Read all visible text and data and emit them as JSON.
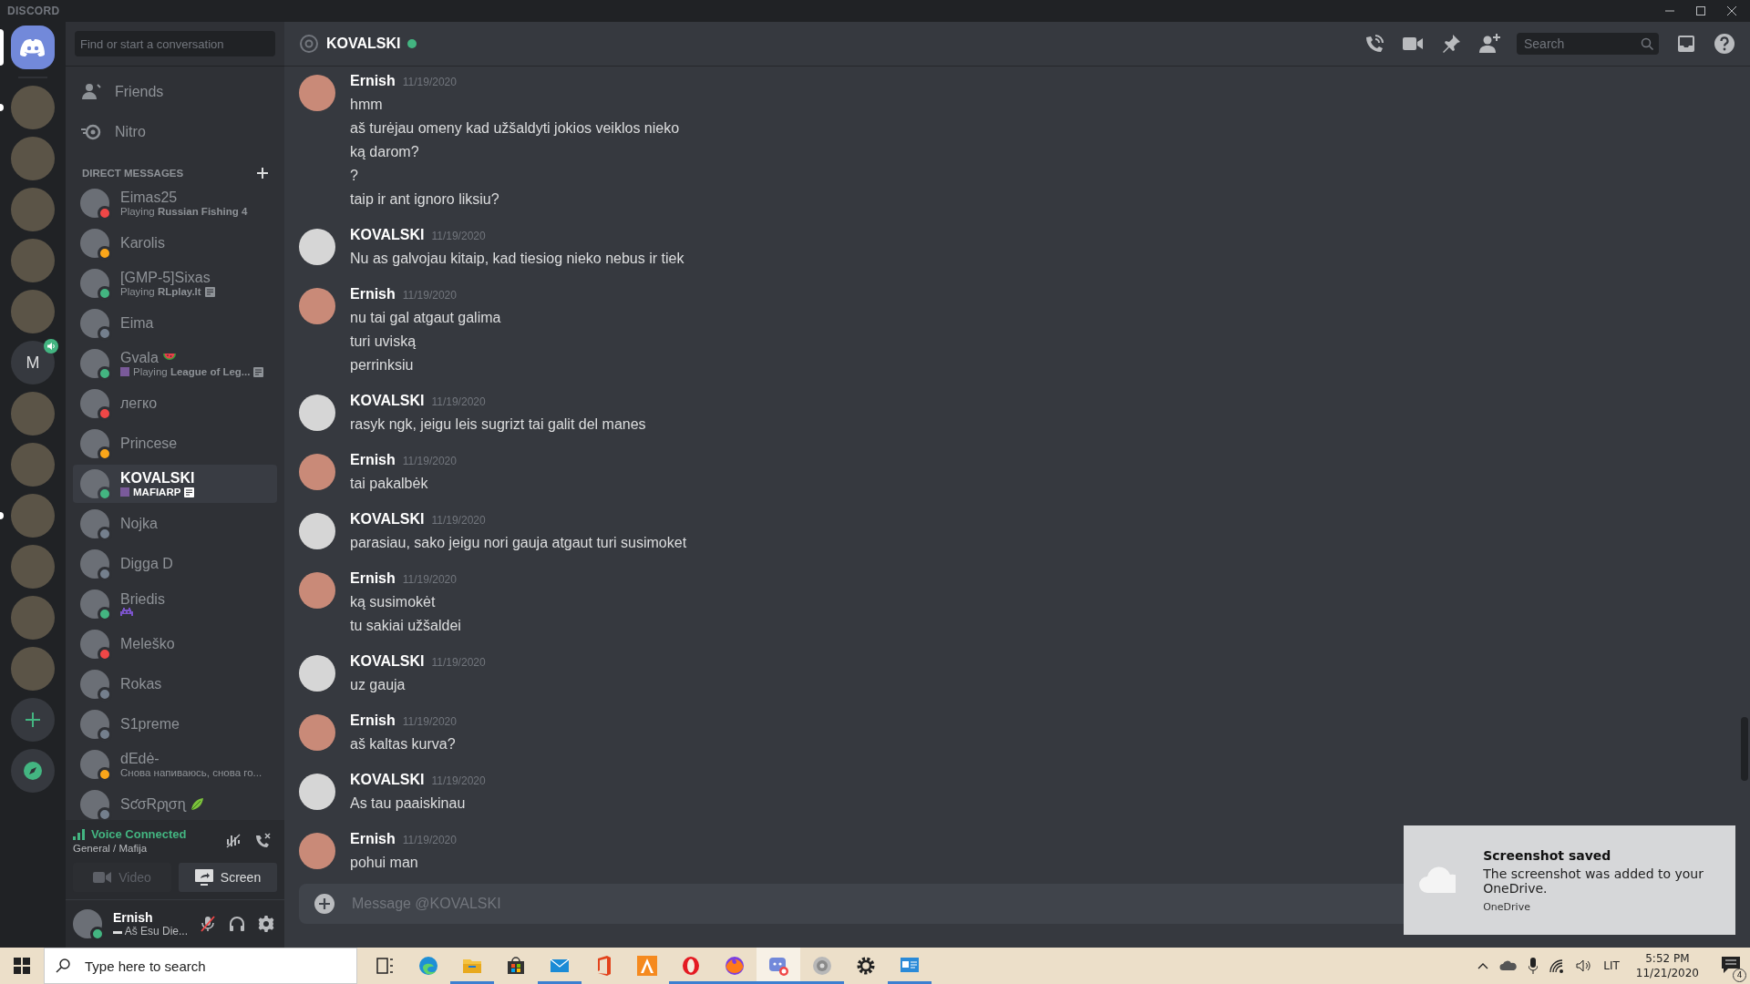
{
  "title_bar": {
    "title": "DISCORD"
  },
  "servers": [
    {
      "kind": "home",
      "selected": true,
      "unread": false,
      "voice": false
    },
    {
      "kind": "photo",
      "selected": false,
      "unread": true,
      "voice": false
    },
    {
      "kind": "photo",
      "selected": false,
      "unread": false,
      "voice": false
    },
    {
      "kind": "photo",
      "selected": false,
      "unread": false,
      "voice": false
    },
    {
      "kind": "photo",
      "selected": false,
      "unread": false,
      "voice": false
    },
    {
      "kind": "photo",
      "selected": false,
      "unread": false,
      "voice": false
    },
    {
      "kind": "letter",
      "label": "M",
      "selected": false,
      "unread": false,
      "voice": true
    },
    {
      "kind": "photo",
      "selected": false,
      "unread": false,
      "voice": false
    },
    {
      "kind": "photo",
      "selected": false,
      "unread": false,
      "voice": false
    },
    {
      "kind": "photo",
      "selected": false,
      "unread": true,
      "voice": false
    },
    {
      "kind": "photo",
      "selected": false,
      "unread": false,
      "voice": false
    },
    {
      "kind": "photo",
      "selected": false,
      "unread": false,
      "voice": false
    },
    {
      "kind": "photo",
      "selected": false,
      "unread": false,
      "voice": false
    },
    {
      "kind": "add",
      "selected": false,
      "unread": false,
      "voice": false
    },
    {
      "kind": "explore",
      "selected": false,
      "unread": false,
      "voice": false
    }
  ],
  "dm_sidebar": {
    "search_button": "Find or start a conversation",
    "nav": [
      {
        "kind": "friends",
        "label": "Friends"
      },
      {
        "kind": "nitro",
        "label": "Nitro"
      }
    ],
    "section_title": "DIRECT MESSAGES",
    "conversations": [
      {
        "name": "Eimas25",
        "activity": {
          "verb": "Playing",
          "name": "Russian Fishing 4"
        },
        "color": "#f04747",
        "selected": false
      },
      {
        "name": "Karolis",
        "color": "#faa61a",
        "selected": false
      },
      {
        "name": "[GMP-5]Sixas",
        "activity": {
          "verb": "Playing",
          "name": "RLplay.lt"
        },
        "details": true,
        "color": "#43b581",
        "selected": false
      },
      {
        "name": "Eima",
        "color": "#747f8d",
        "selected": false
      },
      {
        "name": "Gvala",
        "emoji": {
          "kind": "watermelon"
        },
        "activity": {
          "verb": "Playing",
          "name": "League of Leg..."
        },
        "activity_image": true,
        "details": true,
        "color": "#43b581",
        "selected": false
      },
      {
        "name": "легко",
        "color": "#f04747",
        "selected": false
      },
      {
        "name": "Princese",
        "color": "#faa61a",
        "selected": false
      },
      {
        "name": "KOVALSKI",
        "activity": {
          "name": "MAFIARP"
        },
        "activity_image": true,
        "details": true,
        "color": "#43b581",
        "selected": true
      },
      {
        "name": "Nojka",
        "color": "#747f8d",
        "selected": false
      },
      {
        "name": "Digga D",
        "color": "#747f8d",
        "selected": false
      },
      {
        "name": "Briedis",
        "status_emoji": {
          "kind": "invader"
        },
        "color": "#43b581",
        "selected": false
      },
      {
        "name": "Meleško",
        "color": "#f04747",
        "selected": false
      },
      {
        "name": "Rokas",
        "color": "#747f8d",
        "selected": false
      },
      {
        "name": "S1preme",
        "color": "#747f8d",
        "selected": false
      },
      {
        "name": "dEdė-",
        "status_text": "Снова напиваюсь, снова го...",
        "color": "#faa61a",
        "selected": false
      },
      {
        "name": "SƈσRρʅσɳ",
        "emoji": {
          "kind": "leaf"
        },
        "color": "#747f8d",
        "selected": false
      }
    ]
  },
  "voice": {
    "title": "Voice Connected",
    "channel": "General / Mafija",
    "buttons": [
      {
        "kind": "video",
        "label": "Video",
        "disabled": true
      },
      {
        "kind": "screen",
        "label": "Screen",
        "disabled": false
      }
    ]
  },
  "user": {
    "name": "Ernish",
    "status": "Aš Esu Die...",
    "color": "#43b581",
    "muted": true
  },
  "chat": {
    "header": {
      "name": "KOVALSKI",
      "color": "#43b581",
      "search_placeholder": "Search"
    },
    "messages": [
      {
        "author": "Ernish",
        "date": "11/19/2020",
        "lines": [
          "hmm",
          "aš turėjau omeny kad užšaldyti jokios veiklos nieko",
          "ką darom?",
          "?",
          "taip ir ant ignoro liksiu?"
        ]
      },
      {
        "author": "KOVALSKI",
        "date": "11/19/2020",
        "lines": [
          "Nu as galvojau kitaip, kad tiesiog nieko nebus ir tiek"
        ]
      },
      {
        "author": "Ernish",
        "date": "11/19/2020",
        "lines": [
          "nu tai gal atgaut galima",
          "turi uviską",
          "perrinksiu"
        ]
      },
      {
        "author": "KOVALSKI",
        "date": "11/19/2020",
        "lines": [
          "rasyk ngk, jeigu leis sugrizt tai galit del manes"
        ]
      },
      {
        "author": "Ernish",
        "date": "11/19/2020",
        "lines": [
          "tai pakalbėk"
        ]
      },
      {
        "author": "KOVALSKI",
        "date": "11/19/2020",
        "lines": [
          "parasiau, sako jeigu nori gauja atgaut turi susimoket"
        ]
      },
      {
        "author": "Ernish",
        "date": "11/19/2020",
        "lines": [
          "ką susimokėt",
          "tu sakiai užšaldei"
        ]
      },
      {
        "author": "KOVALSKI",
        "date": "11/19/2020",
        "lines": [
          "uz gauja"
        ]
      },
      {
        "author": "Ernish",
        "date": "11/19/2020",
        "lines": [
          "aš kaltas kurva?"
        ]
      },
      {
        "author": "KOVALSKI",
        "date": "11/19/2020",
        "lines": [
          "As tau paaiskinau"
        ]
      },
      {
        "author": "Ernish",
        "date": "11/19/2020",
        "lines": [
          "pohui man"
        ]
      }
    ],
    "composer": {
      "placeholder": "Message @KOVALSKI"
    }
  },
  "toast": {
    "title": "Screenshot saved",
    "body": "The screenshot was added to your OneDrive.",
    "source": "OneDrive"
  },
  "taskbar": {
    "search_placeholder": "Type here to search",
    "apps": [
      {
        "kind": "taskview",
        "running": false,
        "selected": false
      },
      {
        "kind": "browser",
        "running": false,
        "selected": false
      },
      {
        "kind": "folder",
        "running": true,
        "selected": false
      },
      {
        "kind": "store",
        "running": false,
        "selected": false
      },
      {
        "kind": "mail",
        "running": true,
        "selected": false
      },
      {
        "kind": "office",
        "running": false,
        "selected": false
      },
      {
        "kind": "triangle",
        "running": false,
        "selected": false
      },
      {
        "kind": "ring",
        "running": true,
        "selected": false
      },
      {
        "kind": "fox",
        "running": true,
        "selected": false
      },
      {
        "kind": "chat",
        "running": true,
        "selected": true
      },
      {
        "kind": "speaker",
        "running": true,
        "selected": false
      },
      {
        "kind": "gear",
        "running": false,
        "selected": false
      },
      {
        "kind": "window",
        "running": true,
        "selected": false
      }
    ],
    "tray": {
      "language": "LIT",
      "time": "5:52 PM",
      "date": "11/21/2020",
      "notifications": "4"
    }
  }
}
